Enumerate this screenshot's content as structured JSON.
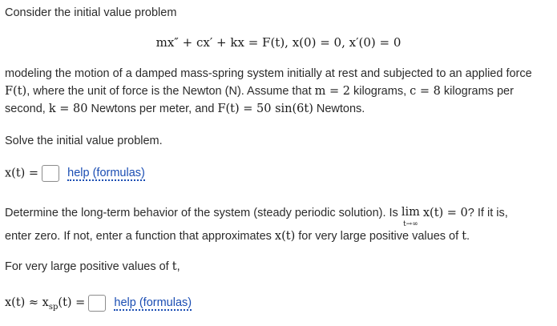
{
  "intro": "Consider the initial value problem",
  "equation": "mx″ + cx′ + kx = F(t),   x(0) = 0,   x′(0) = 0",
  "description": {
    "line1": "modeling the motion of a damped mass-spring system initially at rest and subjected to an applied force",
    "line2_a": "F(t)",
    "line2_b": ", where the unit of force is the Newton (N). Assume that ",
    "line2_m": "m = 2",
    "line2_c_text": " kilograms, ",
    "line2_c": "c = 8",
    "line2_d": " kilograms per",
    "line3_a": "second, ",
    "line3_k": "k = 80",
    "line3_b": " Newtons per meter, and ",
    "line3_F": "F(t) = 50 sin(6t)",
    "line3_c": " Newtons."
  },
  "solve_prompt": "Solve the initial value problem.",
  "answer1": {
    "label": "x(t) =",
    "value": "",
    "help_label": "help (formulas)"
  },
  "longterm": {
    "line1_a": "Determine the long-term behavior of the system (steady periodic solution). Is ",
    "lim_word": "lim",
    "lim_sub": "t→∞",
    "lim_expr": "x(t) = 0",
    "line1_b": "? If it is,",
    "line2_a": "enter zero. If not, enter a function that approximates ",
    "line2_x": "x(t)",
    "line2_b": " for very large positive values of ",
    "line2_t": "t",
    "line2_c": "."
  },
  "large_t_prompt_a": "For very large positive values of ",
  "large_t_prompt_t": "t",
  "large_t_prompt_b": ",",
  "answer2": {
    "label": "x(t) ≈ x",
    "label_sub": "sp",
    "label_end": "(t) =",
    "value": "",
    "help_label": "help (formulas)"
  }
}
